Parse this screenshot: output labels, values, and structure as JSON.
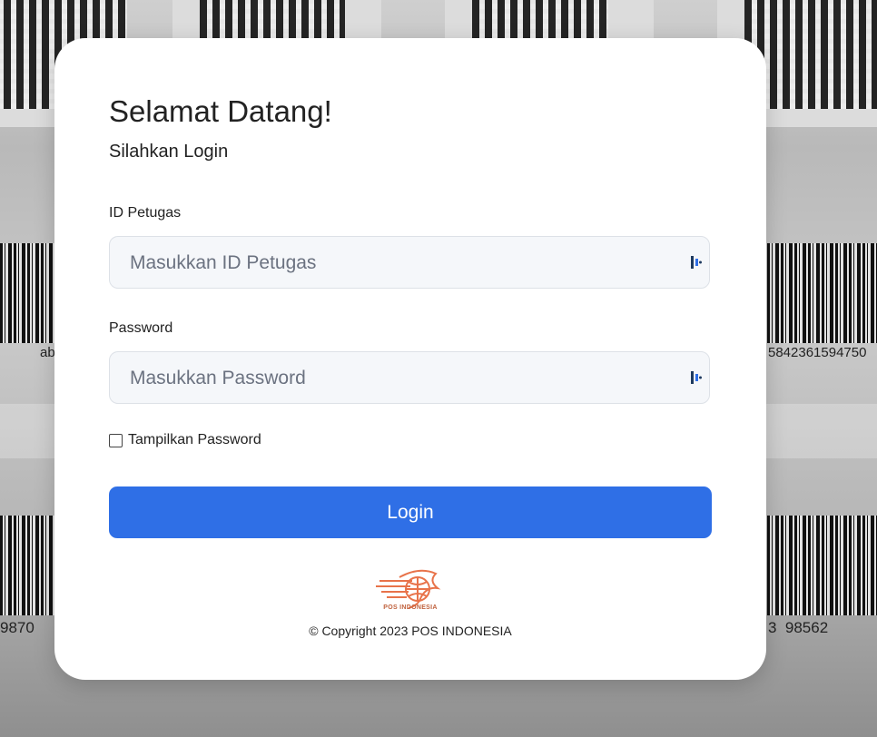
{
  "background": {
    "left_text_1": "ab",
    "right_text_1": "5842361594750",
    "left_text_2": "9870",
    "right_text_2": "3  98562"
  },
  "login": {
    "title": "Selamat Datang!",
    "subtitle": "Silahkan Login",
    "id_label": "ID Petugas",
    "id_placeholder": "Masukkan ID Petugas",
    "id_value": "",
    "password_label": "Password",
    "password_placeholder": "Masukkan Password",
    "password_value": "",
    "show_password_label": "Tampilkan Password",
    "show_password_checked": false,
    "login_button": "Login"
  },
  "footer": {
    "logo_text": "POS INDONESIA",
    "copyright": "© Copyright 2023 POS INDONESIA"
  },
  "colors": {
    "primary": "#2f6fe6",
    "logo": "#e8734a",
    "field_bg": "#f5f7fa"
  },
  "icons": {
    "field_icon": "password-manager-key-icon",
    "logo": "pos-indonesia-logo"
  }
}
